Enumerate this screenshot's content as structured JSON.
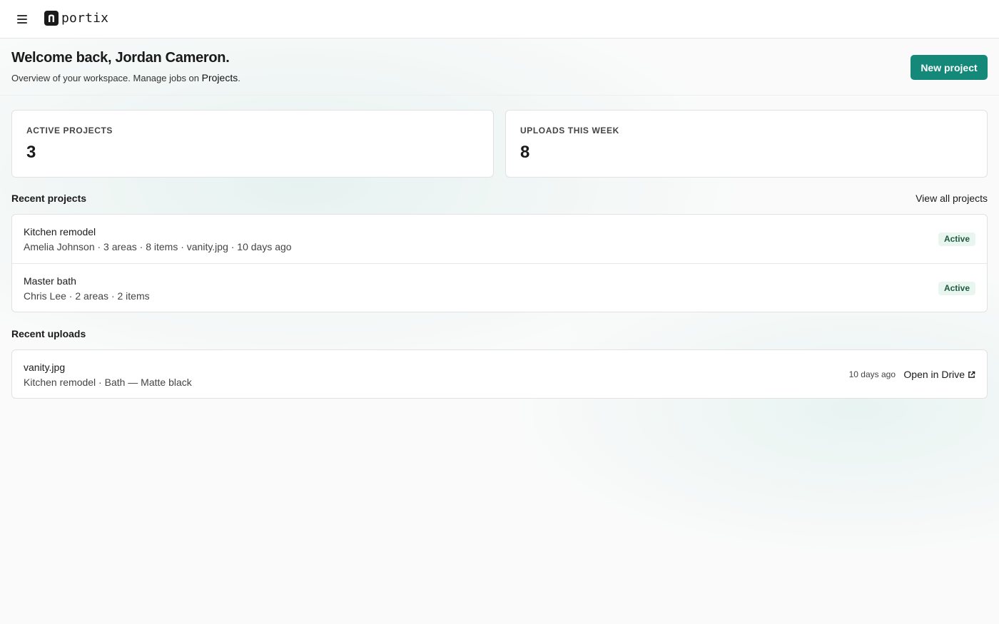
{
  "app": {
    "logo_text": "portix",
    "logo_mark": "n"
  },
  "hero": {
    "welcome": "Welcome back, Jordan Cameron.",
    "subtitle_prefix": "Overview of your workspace. Manage jobs on ",
    "subtitle_link": "Projects",
    "subtitle_suffix": ".",
    "new_project_label": "New project"
  },
  "stats": [
    {
      "label": "ACTIVE PROJECTS",
      "value": "3"
    },
    {
      "label": "UPLOADS THIS WEEK",
      "value": "8"
    }
  ],
  "recent_projects": {
    "title": "Recent projects",
    "view_all_label": "View all projects",
    "items": [
      {
        "name": "Kitchen remodel",
        "meta": "Amelia Johnson · 3 areas · 8 items · vanity.jpg · 10 days ago",
        "status": "Active"
      },
      {
        "name": "Master bath",
        "meta": "Chris Lee · 2 areas · 2 items",
        "status": "Active"
      }
    ]
  },
  "recent_uploads": {
    "title": "Recent uploads",
    "items": [
      {
        "file": "vanity.jpg",
        "meta": "Kitchen remodel · Bath — Matte black",
        "time": "10 days ago",
        "action": "Open in Drive"
      }
    ]
  },
  "colors": {
    "accent": "#14897a",
    "badge_bg": "#e8f6ef",
    "badge_text": "#1f5a3e"
  },
  "icons": {
    "menu": "hamburger-icon",
    "external": "external-link-icon"
  }
}
